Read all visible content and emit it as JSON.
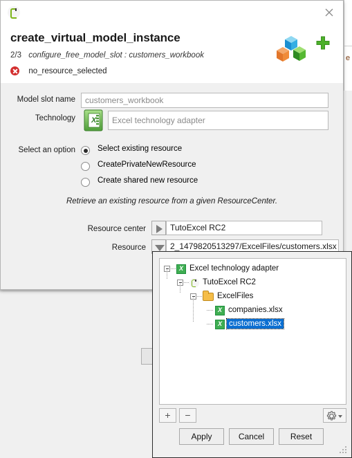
{
  "window": {
    "app_icon": "resource-center-icon",
    "close_label": "close-icon"
  },
  "header": {
    "title": "create_virtual_model_instance",
    "step": "2/3",
    "step_description": "configure_free_model_slot : customers_workbook",
    "error_icon": "error-circle-icon",
    "error_message": "no_resource_selected",
    "cubes_icon": "model-cubes-icon",
    "add_icon": "plus-icon"
  },
  "form": {
    "slot_name_label": "Model slot name",
    "slot_name_value": "customers_workbook",
    "technology_label": "Technology",
    "technology_icon": "excel-icon",
    "technology_value": "Excel technology adapter",
    "option_label": "Select an option",
    "options": [
      {
        "label": "Select existing resource",
        "selected": true
      },
      {
        "label": "CreatePrivateNewResource",
        "selected": false
      },
      {
        "label": "Create shared new resource",
        "selected": false
      }
    ],
    "hint": "Retrieve an existing resource from a given ResourceCenter.",
    "resource_center_label": "Resource center",
    "resource_center_value": "TutoExcel RC2",
    "resource_center_spinner_icon": "triangle-right-icon",
    "resource_label": "Resource",
    "resource_value": "2_1479820513297/ExcelFiles/customers.xlsx",
    "resource_spinner_icon": "triangle-down-icon"
  },
  "popup": {
    "tree": [
      {
        "label": "Excel technology adapter",
        "icon": "excel-icon",
        "depth": 0,
        "expanded": true,
        "selected": false
      },
      {
        "label": "TutoExcel RC2",
        "icon": "resource-center-icon",
        "depth": 1,
        "expanded": true,
        "selected": false
      },
      {
        "label": "ExcelFiles",
        "icon": "folder-icon",
        "depth": 2,
        "expanded": true,
        "selected": false
      },
      {
        "label": "companies.xlsx",
        "icon": "excel-icon",
        "depth": 3,
        "expanded": false,
        "selected": false
      },
      {
        "label": "customers.xlsx",
        "icon": "excel-icon",
        "depth": 3,
        "expanded": false,
        "selected": true
      }
    ],
    "toolbar": {
      "add_label": "+",
      "remove_label": "−",
      "settings_icon": "gear-icon"
    },
    "buttons": {
      "apply": "Apply",
      "cancel": "Cancel",
      "reset": "Reset"
    }
  },
  "colors": {
    "selection_blue": "#0a6ed1",
    "error_red": "#d32f2f",
    "excel_green": "#3fae52",
    "folder_yellow": "#f5bd48",
    "dialog_bg": "#f0f0f0"
  }
}
